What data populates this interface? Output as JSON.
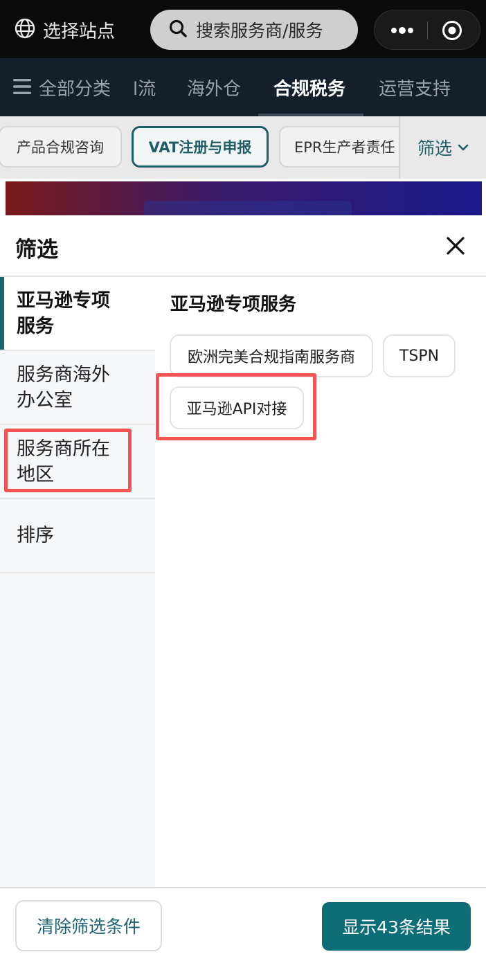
{
  "topbar": {
    "site_label": "选择站点",
    "search_placeholder": "搜索服务商/服务"
  },
  "category_nav": {
    "all_label": "全部分类",
    "items": [
      "l流",
      "海外仓",
      "合规税务",
      "运营支持"
    ],
    "active_index": 2
  },
  "chips": {
    "items": [
      "产品合规咨询",
      "VAT注册与申报",
      "EPR生产者责任"
    ],
    "selected_index": 1,
    "filter_label": "筛选"
  },
  "filter_sheet": {
    "title": "筛选",
    "sidebar": [
      {
        "label": "亚马逊专项服务",
        "active": true
      },
      {
        "label": "服务商海外办公室",
        "active": false
      },
      {
        "label": "服务商所在地区",
        "active": false
      },
      {
        "label": "排序",
        "active": false
      }
    ],
    "section_title": "亚马逊专项服务",
    "options": [
      "欧洲完美合规指南服务商",
      "TSPN",
      "亚马逊API对接"
    ],
    "clear_label": "清除筛选条件",
    "show_results_label": "显示43条结果"
  },
  "colors": {
    "accent": "#0e6e78",
    "highlight": "#f35353"
  }
}
